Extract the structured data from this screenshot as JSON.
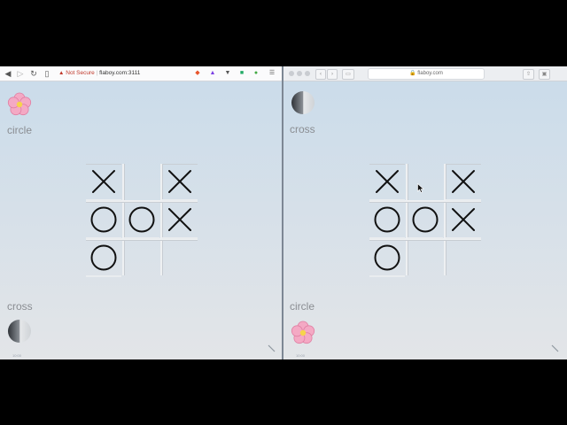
{
  "left_window": {
    "url_warning": "Not Secure",
    "url_text": "flaboy.com:3111",
    "top_player": {
      "label": "circle",
      "icon": "flower-icon"
    },
    "bottom_player": {
      "label": "cross",
      "icon": "half-moon-icon"
    },
    "bottom_subtext": "10:00",
    "board": [
      "X",
      "",
      "X",
      "O",
      "O",
      "X",
      "O",
      "",
      ""
    ]
  },
  "right_window": {
    "url_text": "flaboy.com",
    "top_player": {
      "label": "cross",
      "icon": "half-moon-icon"
    },
    "bottom_player": {
      "label": "circle",
      "icon": "flower-icon"
    },
    "bottom_subtext": "10:00",
    "board": [
      "X",
      "",
      "X",
      "O",
      "O",
      "X",
      "O",
      "",
      ""
    ]
  },
  "colors": {
    "mark": "#111111",
    "label": "#8a8d92",
    "flower": "#f4a9c4",
    "background_top": "#cbdcea",
    "background_bottom": "#e3e5e8"
  }
}
